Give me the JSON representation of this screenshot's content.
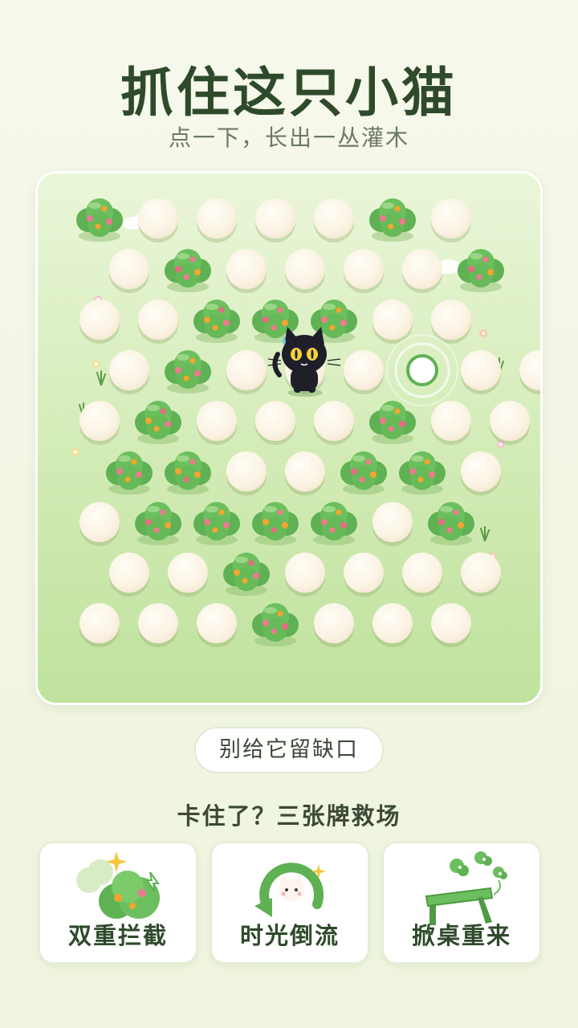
{
  "header": {
    "title": "抓住这只小猫",
    "subtitle": "点一下，长出一丛灌木"
  },
  "board": {
    "rows": [
      "BEEEEBE",
      "EBEEEEB",
      "EEBBBEE",
      "EBEEETEE",
      "EBEEEBEE",
      "BBEEBBE",
      "EBBBBEB",
      "EEBEEEE",
      "EEEBEEE"
    ],
    "cat_cell": [
      3,
      3
    ],
    "legend": {
      "B": "bush",
      "E": "empty-egg",
      "T": "target-ring"
    }
  },
  "tip_pill": "别给它留缺口",
  "cards_heading": "卡住了？三张牌救场",
  "cards": [
    {
      "label": "双重拦截",
      "icon": "double-bush-icon"
    },
    {
      "label": "时光倒流",
      "icon": "undo-arrow-cat-icon"
    },
    {
      "label": "掀桌重来",
      "icon": "flip-table-icon"
    }
  ],
  "colors": {
    "title": "#2f4a2b",
    "bush": "#6cbf5e",
    "egg": "#fbf3e4",
    "board_top": "#eaf6d9",
    "board_bottom": "#bfe29e"
  }
}
